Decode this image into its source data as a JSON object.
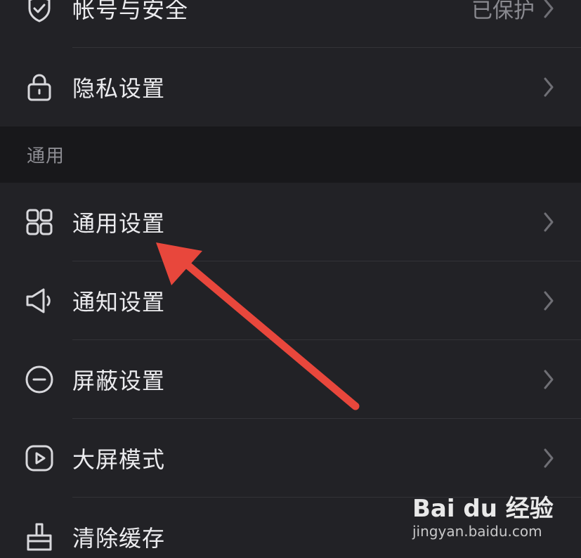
{
  "rows": [
    {
      "label": "帐号与安全",
      "value": "已保护",
      "icon": "shield-check-icon"
    },
    {
      "label": "隐私设置",
      "value": "",
      "icon": "lock-icon"
    },
    {
      "label": "通用设置",
      "value": "",
      "icon": "grid-icon"
    },
    {
      "label": "通知设置",
      "value": "",
      "icon": "speaker-icon"
    },
    {
      "label": "屏蔽设置",
      "value": "",
      "icon": "minus-circle-icon"
    },
    {
      "label": "大屏模式",
      "value": "",
      "icon": "play-screen-icon"
    },
    {
      "label": "清除缓存",
      "value": "",
      "icon": "brush-icon"
    }
  ],
  "section": {
    "title": "通用"
  },
  "watermark": {
    "logo": "Bai du 经验",
    "sub": "jingyan.baidu.com"
  },
  "colors": {
    "background": "#222226",
    "section_bg": "#18181b",
    "arrow": "#e8473c",
    "text": "#ececef",
    "muted": "#8a8a90"
  }
}
